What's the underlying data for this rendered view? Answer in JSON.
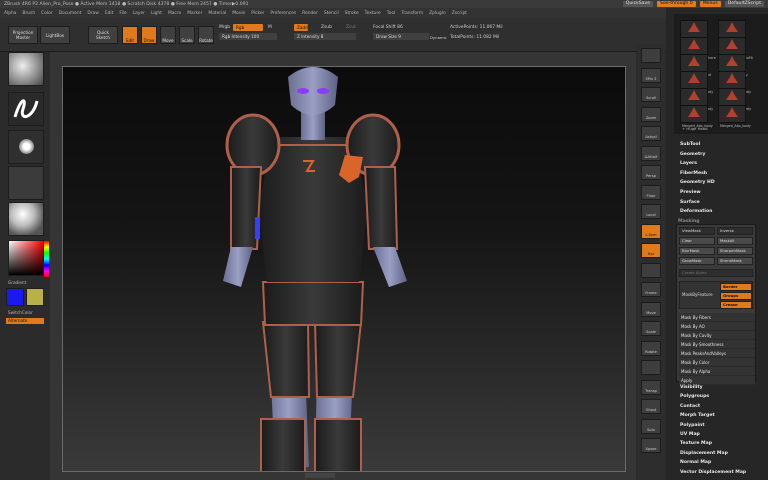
{
  "titlebar": {
    "text": "ZBrush 4R6 P2   Alien_Pro_Pose   ● Active Mem 1418 ● Scratch Disk 4378 ● Free Mem 2457 ● Timer▶0.091",
    "quicksave": "QuickSave",
    "seethrough": "See-through  0",
    "menus_btn": "Menus",
    "script": "DefaultZScript"
  },
  "menubar": [
    "Alpha",
    "Brush",
    "Color",
    "Document",
    "Draw",
    "Edit",
    "File",
    "Layer",
    "Light",
    "Macro",
    "Marker",
    "Material",
    "Movie",
    "Picker",
    "Preferences",
    "Render",
    "Stencil",
    "Stroke",
    "Texture",
    "Tool",
    "Transform",
    "Zplugin",
    "Zscript"
  ],
  "toolbar": {
    "projection_master": "Projection\nMaster",
    "lightbox": "LightBox",
    "quick_sketch": "Quick\nSketch",
    "edit": "Edit",
    "draw": "Draw",
    "move": "Move",
    "scale": "Scale",
    "rotate": "Rotate",
    "mrgb": "Mrgb",
    "rgb": "Rgb",
    "m": "M",
    "rgb_intensity": "Rgb Intensity 100",
    "zadd": "Zadd",
    "zsub": "Zsub",
    "zcut": "Zcut",
    "z_intensity": "Z Intensity 8",
    "focal_shift": "Focal Shift 86",
    "draw_size": "Draw Size 9",
    "dynamic": "Dynamic",
    "active_points": "ActivePoints: 11.067 Mil",
    "total_points": "TotalPoints: 11.082 Mil"
  },
  "left": {
    "gradient": "Gradient",
    "switch_color": "SwitchColor",
    "alternate": "Alternate"
  },
  "shelf": [
    "",
    "SPix 3",
    "Scroll",
    "Zoom",
    "Actual",
    "AAHalf",
    "Persp",
    "Floor",
    "Local",
    "L.Sym",
    "Xyz",
    "",
    "Frame",
    "Move",
    "Scale",
    "Rotate",
    "",
    "Transp",
    "Ghost",
    "Solo",
    "Xpose"
  ],
  "subtools": {
    "items": [
      "ZSphere_1",
      "ZSphere_2",
      "Sim_PM3D_ZSphere",
      "Merged_AbeAutoFit",
      "Merged_Mat_Bod",
      "PM3D_Abs_body",
      "Merged_Abe_Body",
      "Merged_Abe_body",
      "Merged_Abe_body",
      "Merged_Abe_body",
      "Merged_Abs_body",
      "Merged_Abs_body"
    ],
    "more": "+ Huge Head"
  },
  "right_items_top": [
    "SubTool",
    "Geometry",
    "Layers",
    "FiberMesh",
    "Geometry HD",
    "Preview",
    "Surface",
    "Deformation",
    "Masking"
  ],
  "masking": {
    "view_mask": "ViewMask",
    "inverse": "Inverse",
    "clear": "Clear",
    "mask_all": "MaskAll",
    "blur_mask": "BlurMask",
    "sharpen_mask": "SharpenMask",
    "grow_mask": "GrowMask",
    "shrink_mask": "ShrinkMask",
    "create_alpha": "Create Alpha",
    "mask_by_feature": "MaskByFeature",
    "border": "Border",
    "groups": "Groups",
    "crease": "Crease",
    "rows": [
      "Mask By Fibers",
      "Mask By AO",
      "Mask By Cavity",
      "Mask By Smoothness",
      "Mask PeaksAndValleys",
      "Mask By Color",
      "Mask By Alpha",
      "Apply"
    ]
  },
  "right_items_bottom": [
    "Visibility",
    "Polygroups",
    "Contact",
    "Morph Target",
    "Polypaint",
    "UV Map",
    "Texture Map",
    "Displacement Map",
    "Normal Map",
    "Vector Displacement Map"
  ],
  "colors": {
    "accent": "#e07a1a"
  }
}
